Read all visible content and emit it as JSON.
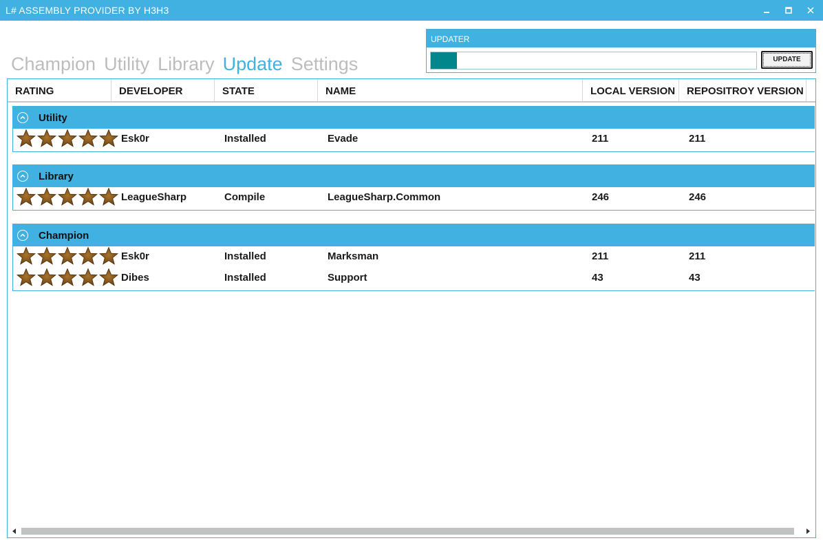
{
  "window": {
    "title": "L# ASSEMBLY PROVIDER BY H3H3",
    "controls": [
      "minimize-icon",
      "maximize-icon",
      "close-icon"
    ]
  },
  "nav": {
    "tabs": [
      {
        "label": "Champion",
        "active": false
      },
      {
        "label": "Utility",
        "active": false
      },
      {
        "label": "Library",
        "active": false
      },
      {
        "label": "Update",
        "active": true
      },
      {
        "label": "Settings",
        "active": false
      }
    ]
  },
  "updater": {
    "title": "UPDATER",
    "progress_percent": 8,
    "button_label": "UPDATE"
  },
  "table": {
    "columns": [
      "RATING",
      "DEVELOPER",
      "STATE",
      "NAME",
      "LOCAL VERSION",
      "REPOSITROY VERSION"
    ],
    "groups": [
      {
        "name": "Utility",
        "rows": [
          {
            "rating": 5,
            "developer": "Esk0r",
            "state": "Installed",
            "name": "Evade",
            "local_version": "211",
            "repository_version": "211"
          }
        ]
      },
      {
        "name": "Library",
        "rows": [
          {
            "rating": 5,
            "developer": "LeagueSharp",
            "state": "Compile",
            "name": "LeagueSharp.Common",
            "local_version": "246",
            "repository_version": "246"
          }
        ]
      },
      {
        "name": "Champion",
        "rows": [
          {
            "rating": 5,
            "developer": "Esk0r",
            "state": "Installed",
            "name": "Marksman",
            "local_version": "211",
            "repository_version": "211"
          },
          {
            "rating": 5,
            "developer": "Dibes",
            "state": "Installed",
            "name": "Support",
            "local_version": "43",
            "repository_version": "43"
          }
        ]
      }
    ]
  },
  "colors": {
    "accent": "#41b1e1",
    "progress": "#00868b",
    "inactive_tab": "#bdbdbd",
    "star": "#8b5a1b"
  }
}
